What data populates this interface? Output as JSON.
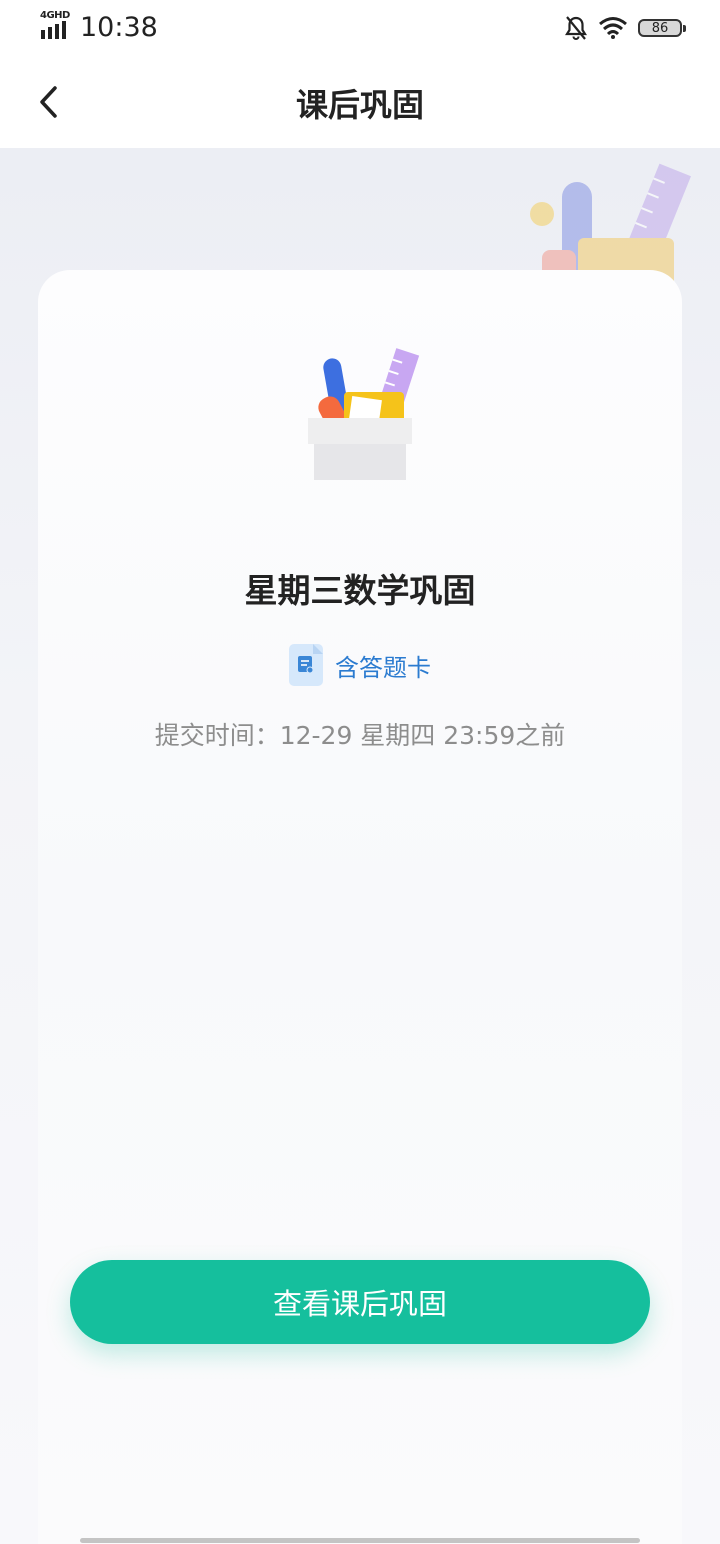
{
  "status_bar": {
    "network": "4GHD",
    "time": "10:38",
    "battery": "86",
    "icons": [
      "signal-icon",
      "bell-off-icon",
      "wifi-icon",
      "battery-icon"
    ]
  },
  "header": {
    "back_icon": "chevron-left-icon",
    "title": "课后巩固"
  },
  "assignment": {
    "title": "星期三数学巩固",
    "answer_card_icon": "document-icon",
    "answer_card_label": "含答题卡",
    "deadline": "提交时间：12-29 星期四 23:59之前"
  },
  "actions": {
    "view_label": "查看课后巩固"
  },
  "colors": {
    "accent": "#15bf9d",
    "link": "#2b7bd0",
    "text": "#222222",
    "muted": "#8d8d8d"
  }
}
